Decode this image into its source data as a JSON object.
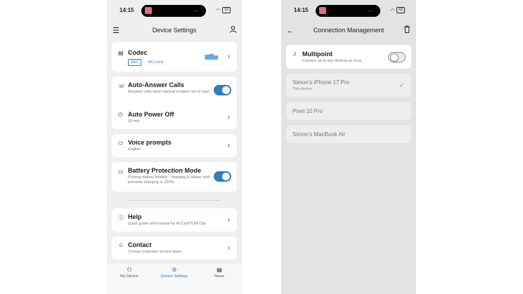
{
  "left": {
    "status": {
      "time": "14:15",
      "battery": "63"
    },
    "header": {
      "title": "Device Settings"
    },
    "codec": {
      "label": "Codec",
      "badge": "AAC",
      "rate": "44.1 kHz"
    },
    "auto_answer": {
      "label": "Auto-Answer Calls",
      "sub": "Answers calls when earbud is taken out of case.",
      "enabled": true
    },
    "auto_power": {
      "label": "Auto Power Off",
      "sub": "15 min"
    },
    "voice": {
      "label": "Voice prompts",
      "sub": "English"
    },
    "battery_mode": {
      "label": "Battery Protection Mode",
      "sub": "Prolong battery lifetime - charging is slower and prevents charging to 100%.",
      "enabled": true
    },
    "help": {
      "label": "Help",
      "sub": "Quick guide and manual for ACCENTUM Clip."
    },
    "contact": {
      "label": "Contact",
      "sub": "Contact customer service team."
    },
    "tabs": [
      {
        "label": "My Device",
        "icon": "earbuds-icon"
      },
      {
        "label": "Device Settings",
        "icon": "gear-icon",
        "active": true
      },
      {
        "label": "News",
        "icon": "news-icon"
      }
    ]
  },
  "right": {
    "status": {
      "time": "14:15",
      "battery": "63"
    },
    "header": {
      "title": "Connection Management"
    },
    "multipoint": {
      "label": "Multipoint",
      "sub": "Connect up to two devices at once.",
      "enabled": false
    },
    "devices": [
      {
        "name": "Simon's iPhone 17 Pro",
        "note": "This device",
        "checked": true
      },
      {
        "name": "Pixel 10 Pro",
        "note": ""
      },
      {
        "name": "Simon's MacBook Air",
        "note": ""
      }
    ]
  },
  "colors": {
    "accent": "#2e7fc3",
    "background": "#efefef",
    "card": "#ffffff"
  }
}
